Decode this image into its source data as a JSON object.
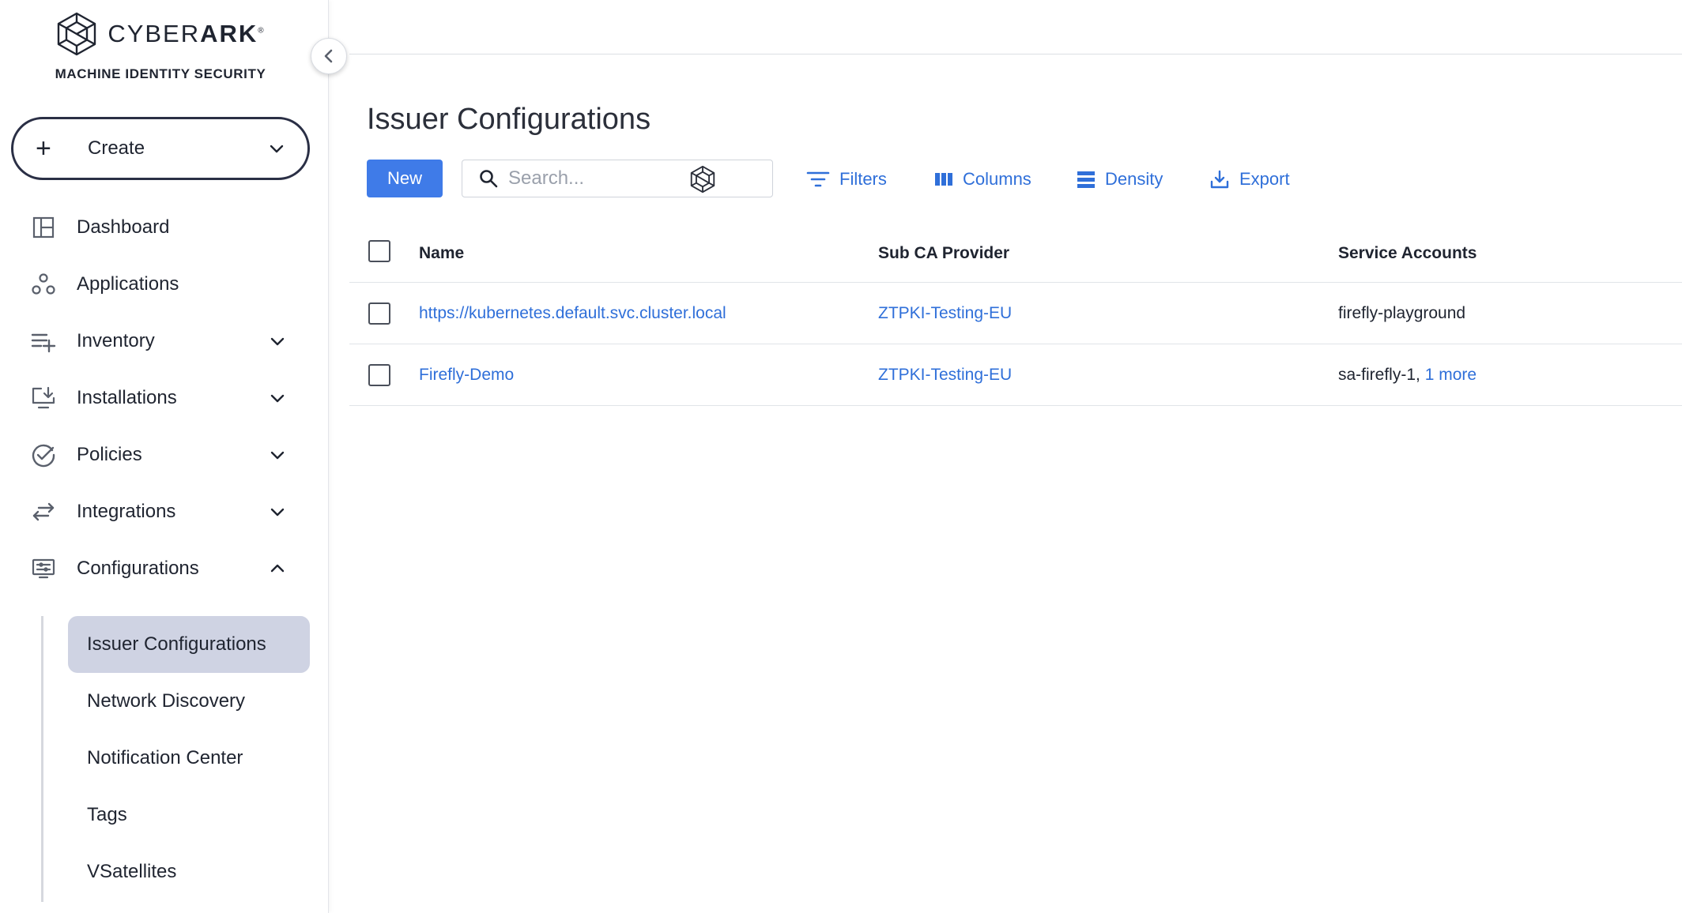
{
  "brand": {
    "name_light": "CYBER",
    "name_bold": "ARK",
    "trademark": "®",
    "subtitle": "MACHINE IDENTITY SECURITY"
  },
  "create": {
    "label": "Create"
  },
  "nav": {
    "dashboard": "Dashboard",
    "applications": "Applications",
    "inventory": "Inventory",
    "installations": "Installations",
    "policies": "Policies",
    "integrations": "Integrations",
    "configurations": "Configurations"
  },
  "subnav": {
    "issuer_configurations": "Issuer Configurations",
    "network_discovery": "Network Discovery",
    "notification_center": "Notification Center",
    "tags": "Tags",
    "vsatellites": "VSatellites"
  },
  "page": {
    "title": "Issuer Configurations"
  },
  "toolbar": {
    "new_label": "New",
    "search_placeholder": "Search...",
    "filters": "Filters",
    "columns": "Columns",
    "density": "Density",
    "export": "Export"
  },
  "table": {
    "headers": {
      "name": "Name",
      "sub_ca": "Sub CA Provider",
      "service_accounts": "Service Accounts"
    },
    "rows": [
      {
        "name": "https://kubernetes.default.svc.cluster.local",
        "sub_ca": "ZTPKI-Testing-EU",
        "service_accounts": "firefly-playground",
        "more": ""
      },
      {
        "name": "Firefly-Demo",
        "sub_ca": "ZTPKI-Testing-EU",
        "service_accounts": "sa-firefly-1,",
        "more": "1 more"
      }
    ]
  },
  "colors": {
    "accent": "#3f7be8",
    "link": "#2f6fd9",
    "active_bg": "#cfd3e3",
    "text": "#1f2430"
  }
}
